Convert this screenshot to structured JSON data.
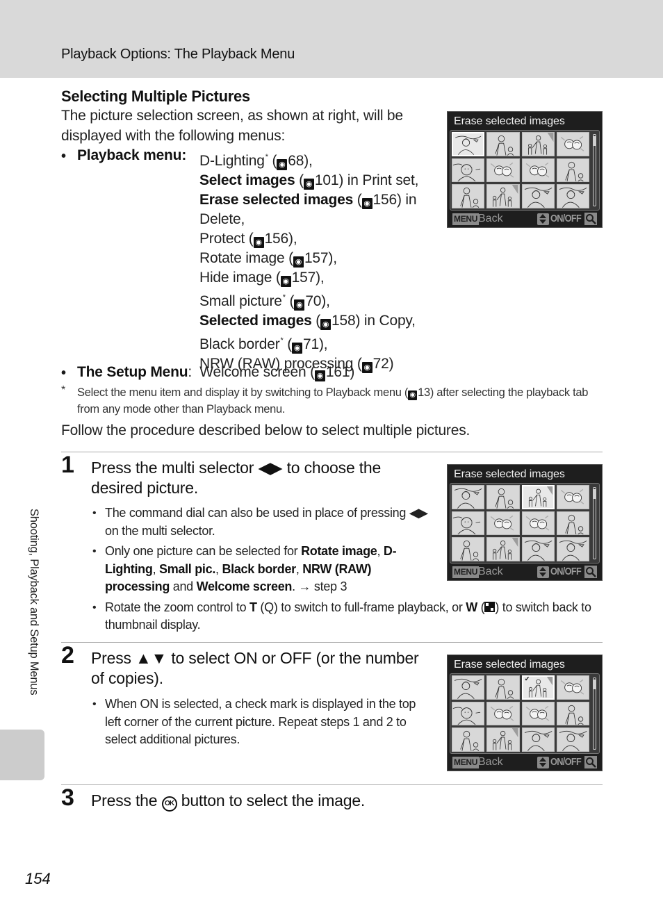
{
  "header": {
    "title": "Playback Options: The Playback Menu"
  },
  "section": {
    "title": "Selecting Multiple Pictures",
    "intro": "The picture selection screen, as shown at right, will be displayed with the following menus:"
  },
  "playback_menu": {
    "label": "Playback menu",
    "items": [
      {
        "bold": "",
        "text": "D-Lighting",
        "star": true,
        "ref": "68",
        "suffix": ","
      },
      {
        "bold": "Select images",
        "text": "",
        "star": false,
        "ref": "101",
        "suffix": " in Print set,"
      },
      {
        "bold": "Erase selected images",
        "text": "",
        "star": false,
        "ref": "156",
        "suffix": " in Delete,"
      },
      {
        "bold": "",
        "text": "Protect",
        "star": false,
        "ref": "156",
        "suffix": ","
      },
      {
        "bold": "",
        "text": "Rotate image",
        "star": false,
        "ref": "157",
        "suffix": ","
      },
      {
        "bold": "",
        "text": "Hide image",
        "star": false,
        "ref": "157",
        "suffix": ","
      },
      {
        "bold": "",
        "text": "Small picture",
        "star": true,
        "ref": "70",
        "suffix": ","
      },
      {
        "bold": "Selected images",
        "text": "",
        "star": false,
        "ref": "158",
        "suffix": " in Copy,"
      },
      {
        "bold": "",
        "text": "Black border",
        "star": true,
        "ref": "71",
        "suffix": ","
      },
      {
        "bold": "",
        "text": "NRW (RAW) processing",
        "star": false,
        "ref": "72",
        "suffix": ""
      }
    ]
  },
  "setup_menu": {
    "label": "The Setup Menu",
    "text": "Welcome screen",
    "ref": "161"
  },
  "footnote": {
    "star": "*",
    "text_before": "Select the menu item and display it by switching to Playback menu (",
    "ref": "13",
    "text_after": ") after selecting the playback tab from any mode other than Playback menu."
  },
  "follow_text": "Follow the procedure described below to select multiple pictures.",
  "steps": [
    {
      "number": "1",
      "title_before": "Press the multi selector ",
      "title_glyph": "◀▶",
      "title_after": " to choose the desired picture.",
      "bullets": {
        "b1_before": "The command dial can also be used in place of pressing ",
        "b1_glyph": "◀▶",
        "b1_after": " on the multi selector.",
        "b2_pre": "Only one picture can be selected for ",
        "b2_items": [
          "Rotate image",
          "D-Lighting",
          "Small pic.",
          "Black border",
          "NRW (RAW) processing",
          "Welcome screen"
        ],
        "b2_and": " and ",
        "b2_post": ". → step 3",
        "b3_pre": "Rotate the zoom control to ",
        "b3_t": "T",
        "b3_t_icon": "Q",
        "b3_mid": " to switch to full-frame playback, or ",
        "b3_w": "W",
        "b3_post": " to switch back to thumbnail display."
      }
    },
    {
      "number": "2",
      "title_before": "Press ",
      "title_glyph": "▲▼",
      "title_after": " to select ON or OFF (or the number of copies).",
      "bullets": {
        "b1": "When ON is selected, a check mark is displayed in the top left corner of the current picture. Repeat steps 1 and 2 to select additional pictures."
      }
    },
    {
      "number": "3",
      "title_before": "Press the ",
      "title_glyph": "OK",
      "title_after": " button to select the image."
    }
  ],
  "camera_screens": [
    {
      "title": "Erase selected images",
      "selected_index": 0,
      "checked_index": -1,
      "back_key": "MENU",
      "back_label": "Back",
      "toggle_label": "ON/OFF"
    },
    {
      "title": "Erase selected images",
      "selected_index": 2,
      "checked_index": -1,
      "back_key": "MENU",
      "back_label": "Back",
      "toggle_label": "ON/OFF"
    },
    {
      "title": "Erase selected images",
      "selected_index": 2,
      "checked_index": 2,
      "back_key": "MENU",
      "back_label": "Back",
      "toggle_label": "ON/OFF"
    }
  ],
  "thumbnails": [
    "woman-landscape",
    "woman-child",
    "family",
    "flowers",
    "woman-portrait",
    "flowers",
    "flowers",
    "woman-child",
    "woman-child",
    "family",
    "woman-landscape",
    "woman-landscape"
  ],
  "side_tab": {
    "label": "Shooting, Playback and Setup Menus"
  },
  "page_number": "154"
}
